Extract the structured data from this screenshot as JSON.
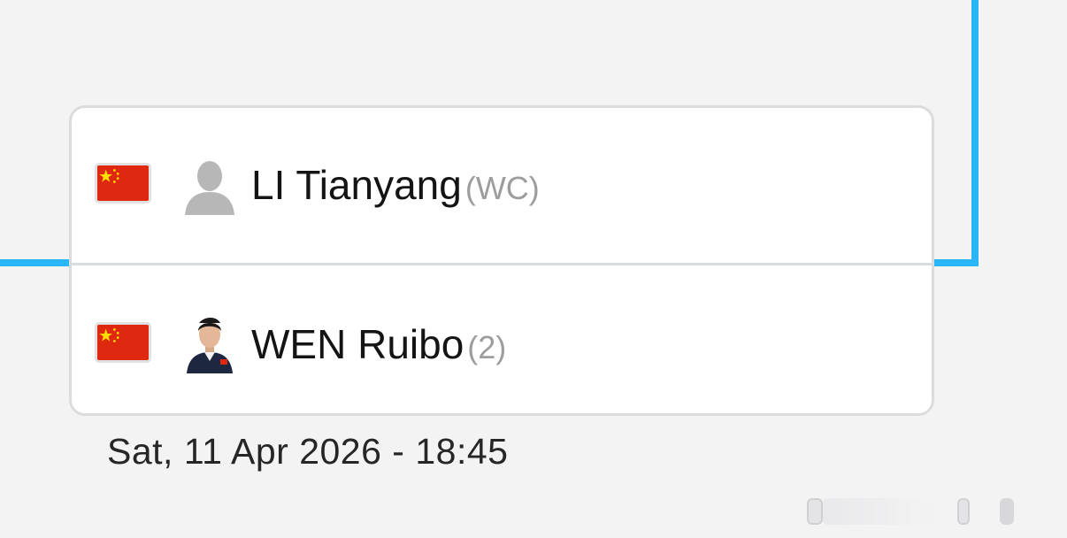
{
  "colors": {
    "bracket_accent": "#29b6f6",
    "flag_red": "#de2910",
    "flag_star": "#ffde00"
  },
  "match": {
    "players": [
      {
        "name": "LI Tianyang",
        "tag": "(WC)",
        "country_flag_icon": "china-flag-icon",
        "avatar_icon": "default-person-avatar-icon"
      },
      {
        "name": "WEN Ruibo",
        "tag": "(2)",
        "country_flag_icon": "china-flag-icon",
        "avatar_icon": "player-photo-avatar"
      }
    ],
    "datetime": "Sat, 11 Apr 2026 - 18:45"
  }
}
